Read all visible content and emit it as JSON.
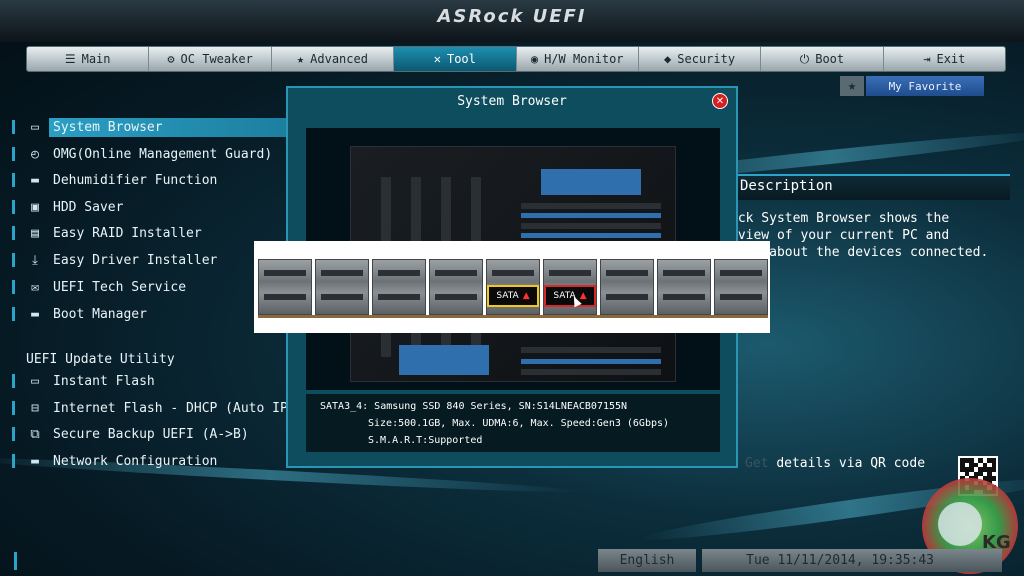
{
  "app": {
    "brand": "ASRock UEFI"
  },
  "tabs": [
    {
      "label": "Main",
      "icon": "list-icon"
    },
    {
      "label": "OC Tweaker",
      "icon": "tweaker-icon"
    },
    {
      "label": "Advanced",
      "icon": "star-icon"
    },
    {
      "label": "Tool",
      "icon": "wrench-icon",
      "active": true
    },
    {
      "label": "H/W Monitor",
      "icon": "monitor-icon"
    },
    {
      "label": "Security",
      "icon": "shield-icon"
    },
    {
      "label": "Boot",
      "icon": "power-icon"
    },
    {
      "label": "Exit",
      "icon": "exit-icon"
    }
  ],
  "favorite": {
    "label": "My Favorite"
  },
  "menu": {
    "items": [
      {
        "label": "System Browser",
        "icon": "browser-icon",
        "active": true
      },
      {
        "label": "OMG(Online Management Guard)",
        "icon": "clock-icon"
      },
      {
        "label": "Dehumidifier Function",
        "icon": "folder-icon"
      },
      {
        "label": "HDD Saver",
        "icon": "hdd-icon"
      },
      {
        "label": "Easy RAID Installer",
        "icon": "raid-icon"
      },
      {
        "label": "Easy Driver Installer",
        "icon": "download-icon"
      },
      {
        "label": "UEFI Tech Service",
        "icon": "email-icon"
      },
      {
        "label": "Boot Manager",
        "icon": "folder-icon"
      }
    ],
    "section_heading": "UEFI Update Utility",
    "update_items": [
      {
        "label": "Instant Flash",
        "icon": "flash-icon"
      },
      {
        "label": "Internet Flash - DHCP (Auto IP), A",
        "icon": "network-icon"
      },
      {
        "label": "Secure Backup UEFI  (A->B)",
        "icon": "backup-icon"
      },
      {
        "label": "Network Configuration",
        "icon": "folder-icon"
      }
    ]
  },
  "description": {
    "title": "Description",
    "lines": [
      "ock System Browser shows the",
      "rview of your current PC and",
      "tion about the devices connected."
    ],
    "qr_label": "details via QR code",
    "qr_prefix": "Get"
  },
  "dialog": {
    "title": "System Browser",
    "close_icon": "close-icon",
    "zoom": {
      "ports": [
        {
          "label": ""
        },
        {
          "label": ""
        },
        {
          "label": ""
        },
        {
          "label": ""
        },
        {
          "label": "SATA",
          "highlight": "yellow"
        },
        {
          "label": "SATA",
          "highlight": "red"
        },
        {
          "label": ""
        },
        {
          "label": ""
        },
        {
          "label": ""
        }
      ]
    },
    "info": {
      "line1": "SATA3_4: Samsung SSD 840 Series, SN:S14LNEACB07155N",
      "line2": "Size:500.1GB, Max. UDMA:6, Max. Speed:Gen3 (6Gbps)",
      "line3": "S.M.A.R.T:Supported"
    }
  },
  "footer": {
    "language": "English",
    "datetime": "Tue 11/11/2014, 19:35:43"
  },
  "watermark": {
    "text": "KG"
  },
  "colors": {
    "accent": "#2aa4c8",
    "active_tab": "#1d8fb0",
    "highlight_yellow": "#f2c81e",
    "highlight_red": "#d62a2a"
  }
}
